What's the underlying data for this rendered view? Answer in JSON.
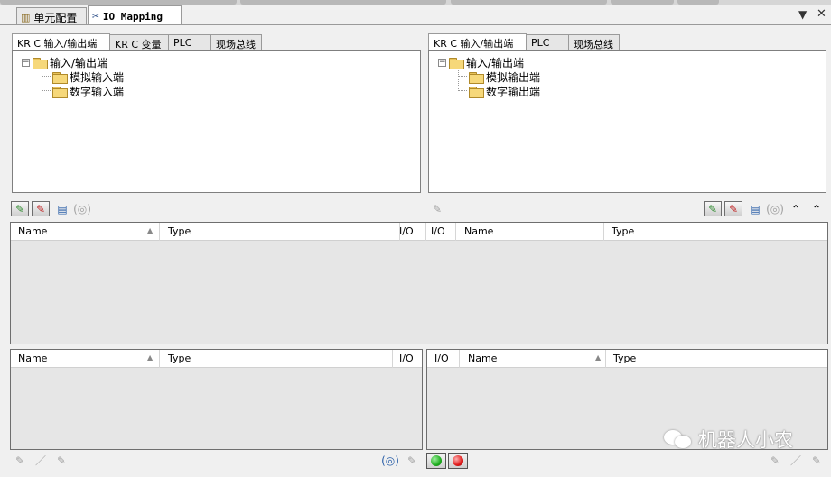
{
  "document_tabs": [
    {
      "label": "单元配置",
      "icon": "cell-config-icon",
      "active": false
    },
    {
      "label": "IO Mapping",
      "icon": "io-mapping-icon",
      "active": true
    }
  ],
  "window_controls": {
    "dropdown_glyph": "▼",
    "close_glyph": "✕"
  },
  "left_panel": {
    "tabs": [
      "KR C 输入/输出端",
      "KR C 变量",
      "PLC",
      "现场总线"
    ],
    "active_tab": "KR C 输入/输出端",
    "tree": {
      "root": "输入/输出端",
      "children": [
        "模拟输入端",
        "数字输入端"
      ]
    }
  },
  "right_panel": {
    "tabs": [
      "KR C 输入/输出端",
      "PLC",
      "现场总线"
    ],
    "active_tab": "KR C 输入/输出端",
    "tree": {
      "root": "输入/输出端",
      "children": [
        "模拟输出端",
        "数字输出端"
      ]
    }
  },
  "main_grid": {
    "left_columns": [
      "Name",
      "Type",
      "I/O"
    ],
    "right_columns": [
      "I/O",
      "Name",
      "Type"
    ]
  },
  "bottom_left_grid": {
    "columns": [
      "Name",
      "Type",
      "I/O"
    ]
  },
  "bottom_right_grid": {
    "columns": [
      "I/O",
      "Name",
      "Type"
    ]
  },
  "colors": {
    "led_green": "#1fae1f",
    "led_red": "#e01818",
    "connected_plug": "#2e8b2e",
    "disconnected_plug": "#c02020"
  },
  "watermark": {
    "text": "机器人小农"
  }
}
